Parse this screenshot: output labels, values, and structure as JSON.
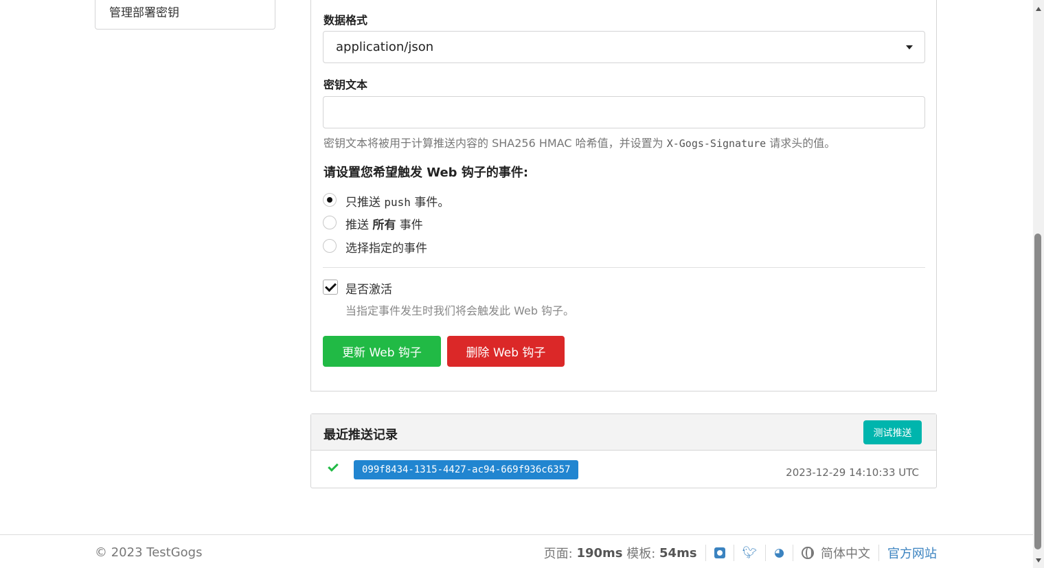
{
  "sidebar": {
    "items": [
      {
        "label": "管理部署密钥"
      }
    ]
  },
  "form": {
    "content_type_label": "数据格式",
    "content_type_value": "application/json",
    "secret_label": "密钥文本",
    "secret_value": "",
    "secret_help_prefix": "密钥文本将被用于计算推送内容的 SHA256 HMAC 哈希值，并设置为 ",
    "secret_help_code": "X-Gogs-Signature",
    "secret_help_suffix": " 请求头的值。",
    "events_title": "请设置您希望触发 Web 钩子的事件:",
    "events": [
      {
        "prefix": "只推送 ",
        "code": "push",
        "suffix": " 事件。",
        "checked": true
      },
      {
        "prefix": "推送 ",
        "bold": "所有",
        "suffix": " 事件",
        "checked": false
      },
      {
        "label": "选择指定的事件",
        "checked": false
      }
    ],
    "active_label": "是否激活",
    "active_checked": true,
    "active_help": "当指定事件发生时我们将会触发此 Web 钩子。",
    "update_button": "更新 Web 钩子",
    "delete_button": "删除 Web 钩子"
  },
  "deliveries": {
    "title": "最近推送记录",
    "test_button": "测试推送",
    "items": [
      {
        "status": "success",
        "uuid": "099f8434-1315-4427-ac94-669f936c6357",
        "time": "2023-12-29 14:10:33 UTC"
      }
    ]
  },
  "footer": {
    "copyright": "© 2023 TestGogs",
    "page_label": "页面:",
    "page_time": "190ms",
    "template_label": "模板:",
    "template_time": "54ms",
    "icons": [
      "github-icon",
      "twitter-icon",
      "weibo-icon",
      "globe-icon"
    ],
    "language": "简体中文",
    "official_site": "官方网站"
  },
  "colors": {
    "green": "#21ba45",
    "red": "#db2828",
    "teal": "#00b5ad",
    "blue": "#2185d0",
    "link": "#3b83c0"
  }
}
